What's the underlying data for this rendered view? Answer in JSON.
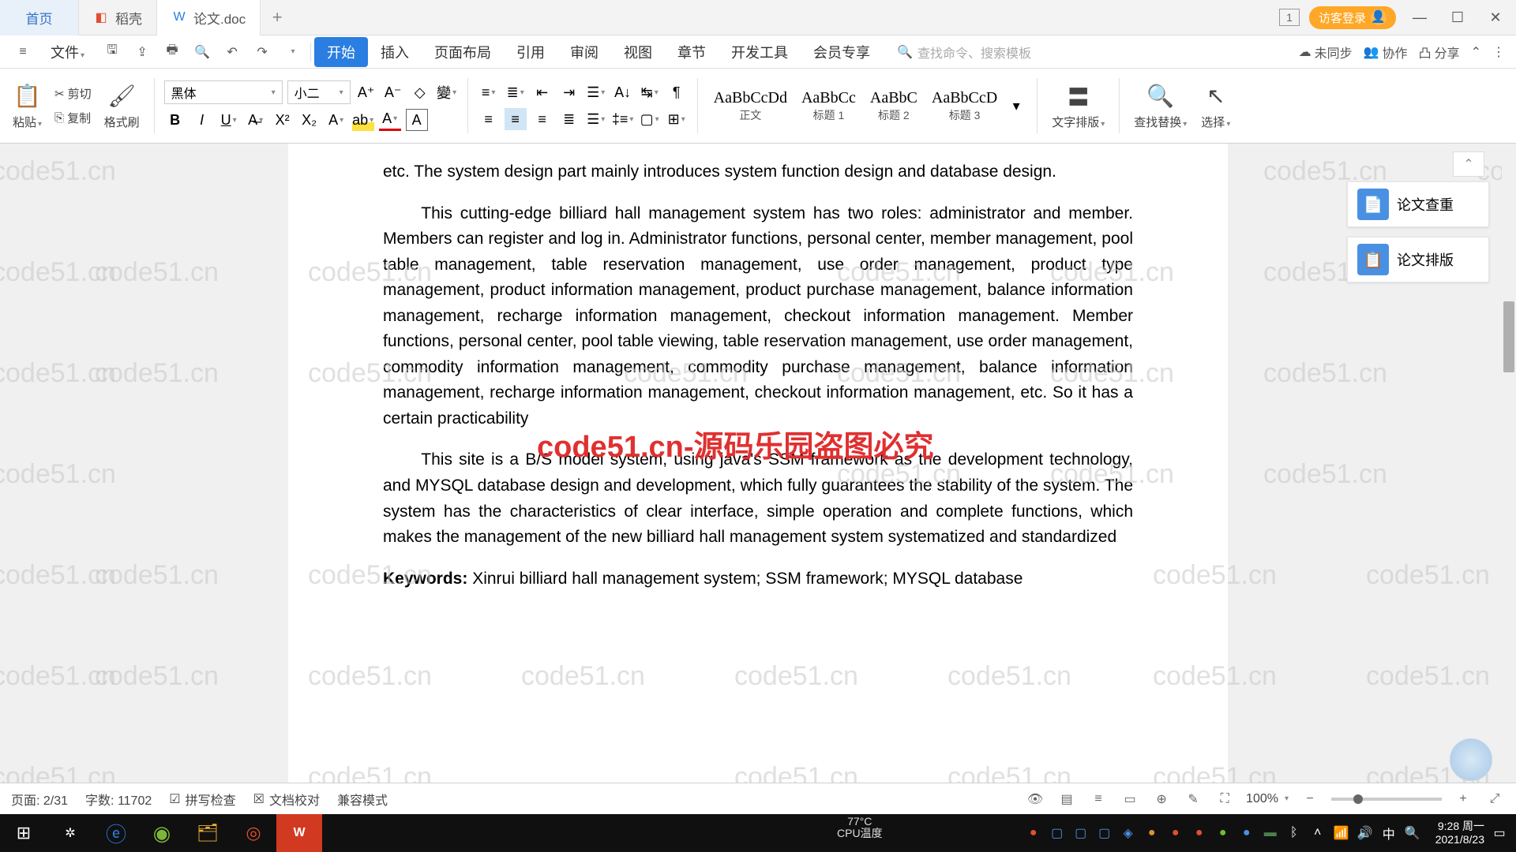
{
  "tabs": {
    "home": "首页",
    "daoke": "稻壳",
    "doc": "论文.doc"
  },
  "titlebar": {
    "counter": "1",
    "login": "访客登录"
  },
  "menubar": {
    "file": "文件",
    "items": [
      "开始",
      "插入",
      "页面布局",
      "引用",
      "审阅",
      "视图",
      "章节",
      "开发工具",
      "会员专享"
    ],
    "search_placeholder": "查找命令、搜索模板",
    "unsynced": "未同步",
    "collab": "协作",
    "share": "分享"
  },
  "ribbon": {
    "paste": "粘贴",
    "cut": "剪切",
    "copy": "复制",
    "format_painter": "格式刷",
    "font_name": "黑体",
    "font_size": "小二",
    "styles": [
      {
        "preview": "AaBbCcDd",
        "label": "正文"
      },
      {
        "preview": "AaBbCc",
        "label": "标题 1"
      },
      {
        "preview": "AaBbC",
        "label": "标题 2"
      },
      {
        "preview": "AaBbCcD",
        "label": "标题 3"
      }
    ],
    "text_layout": "文字排版",
    "find_replace": "查找替换",
    "select": "选择"
  },
  "sidepanel": {
    "check": "论文查重",
    "layout": "论文排版"
  },
  "document": {
    "p1": "etc. The system design part mainly introduces system function design and database design.",
    "p2": "This cutting-edge billiard hall management system has two roles: administrator and member. Members can register and log in. Administrator functions, personal center, member management, pool table management, table reservation management, use order management, product type management, product information management, product purchase management, balance information management, recharge information management, checkout information management. Member functions, personal center, pool table viewing, table reservation management, use order management, commodity information management, commodity purchase management, balance information management, recharge information management, checkout information management, etc. So it has a certain practicability",
    "p3": "This site is a B/S model system, using java's SSM framework as the development technology, and MYSQL database design and development, which fully guarantees the stability of the system. The system has the characteristics of clear interface, simple operation and complete functions, which makes the management of the new billiard hall management system systematized and standardized",
    "kw_label": "Keywords:",
    "kw_text": " Xinrui billiard hall management system; SSM framework; MYSQL database"
  },
  "statusbar": {
    "page": "页面: 2/31",
    "words": "字数: 11702",
    "spell": "拼写检查",
    "proof": "文档校对",
    "compat": "兼容模式",
    "zoom": "100%"
  },
  "taskbar": {
    "temp_val": "77°C",
    "temp_lab": "CPU温度",
    "time": "9:28 周一",
    "date": "2021/8/23"
  },
  "watermark": {
    "text": "code51.cn",
    "red": "code51.cn-源码乐园盗图必究"
  }
}
